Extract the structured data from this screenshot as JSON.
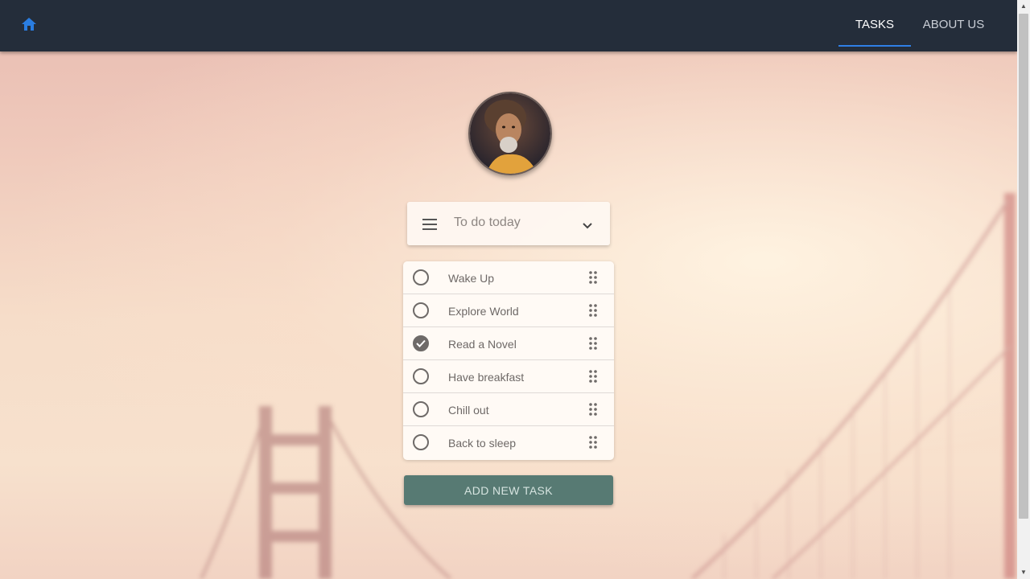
{
  "nav": {
    "home_icon": "home-icon",
    "tabs": [
      {
        "label": "TASKS",
        "active": true
      },
      {
        "label": "ABOUT US",
        "active": false
      }
    ],
    "accent": "#2f7fe6"
  },
  "profile": {
    "avatar": "avatar"
  },
  "list_selector": {
    "menu_icon": "menu-icon",
    "selected": "To do today",
    "dropdown_icon": "chevron-down-icon"
  },
  "tasks": [
    {
      "label": "Wake Up",
      "done": false
    },
    {
      "label": "Explore World",
      "done": false
    },
    {
      "label": "Read a Novel",
      "done": true
    },
    {
      "label": "Have breakfast",
      "done": false
    },
    {
      "label": "Chill out",
      "done": false
    },
    {
      "label": "Back to sleep",
      "done": false
    }
  ],
  "add_button": {
    "label": "ADD NEW TASK",
    "color": "#577a73"
  }
}
